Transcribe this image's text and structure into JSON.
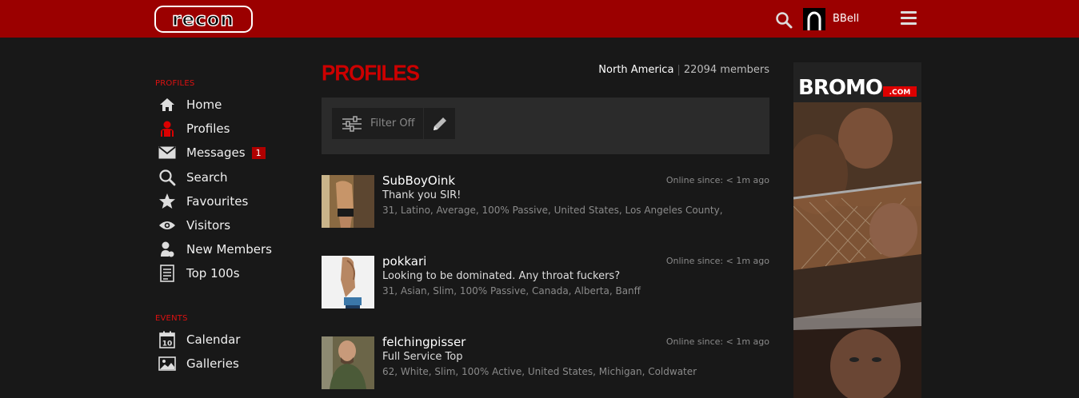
{
  "header": {
    "logo_text": "recon",
    "username": "BBell"
  },
  "sidebar": {
    "profiles_section": "PROFILES",
    "items": [
      {
        "label": "Home",
        "icon": "home-icon"
      },
      {
        "label": "Profiles",
        "icon": "profiles-icon"
      },
      {
        "label": "Messages",
        "icon": "envelope-icon",
        "badge": "1"
      },
      {
        "label": "Search",
        "icon": "search-icon"
      },
      {
        "label": "Favourites",
        "icon": "star-icon"
      },
      {
        "label": "Visitors",
        "icon": "eye-icon"
      },
      {
        "label": "New Members",
        "icon": "new-member-icon"
      },
      {
        "label": "Top 100s",
        "icon": "list-icon"
      }
    ],
    "events_section": "EVENTS",
    "event_items": [
      {
        "label": "Calendar",
        "icon": "calendar-icon",
        "day": "10"
      },
      {
        "label": "Galleries",
        "icon": "image-icon"
      }
    ]
  },
  "main": {
    "title": "PROFILES",
    "region": "North America",
    "members": "22094 members",
    "filter_label": "Filter Off",
    "profiles": [
      {
        "name": "SubBoyOink",
        "tagline": "Thank you SIR!",
        "info": "31, Latino, Average, 100% Passive, United States, Los Angeles County,",
        "status": "Online since: < 1m ago"
      },
      {
        "name": "pokkari",
        "tagline": "Looking to be dominated. Any throat fuckers?",
        "info": "31, Asian, Slim, 100% Passive, Canada, Alberta, Banff",
        "status": "Online since: < 1m ago"
      },
      {
        "name": "felchingpisser",
        "tagline": "Full Service Top",
        "info": "62, White, Slim, 100% Active, United States, Michigan, Coldwater",
        "status": "Online since: < 1m ago"
      }
    ]
  },
  "ad": {
    "brand": "BROMO",
    "domain": ".COM"
  },
  "colors": {
    "header_bg": "#9b0000",
    "accent_red": "#cc0000",
    "page_bg": "#181818"
  }
}
